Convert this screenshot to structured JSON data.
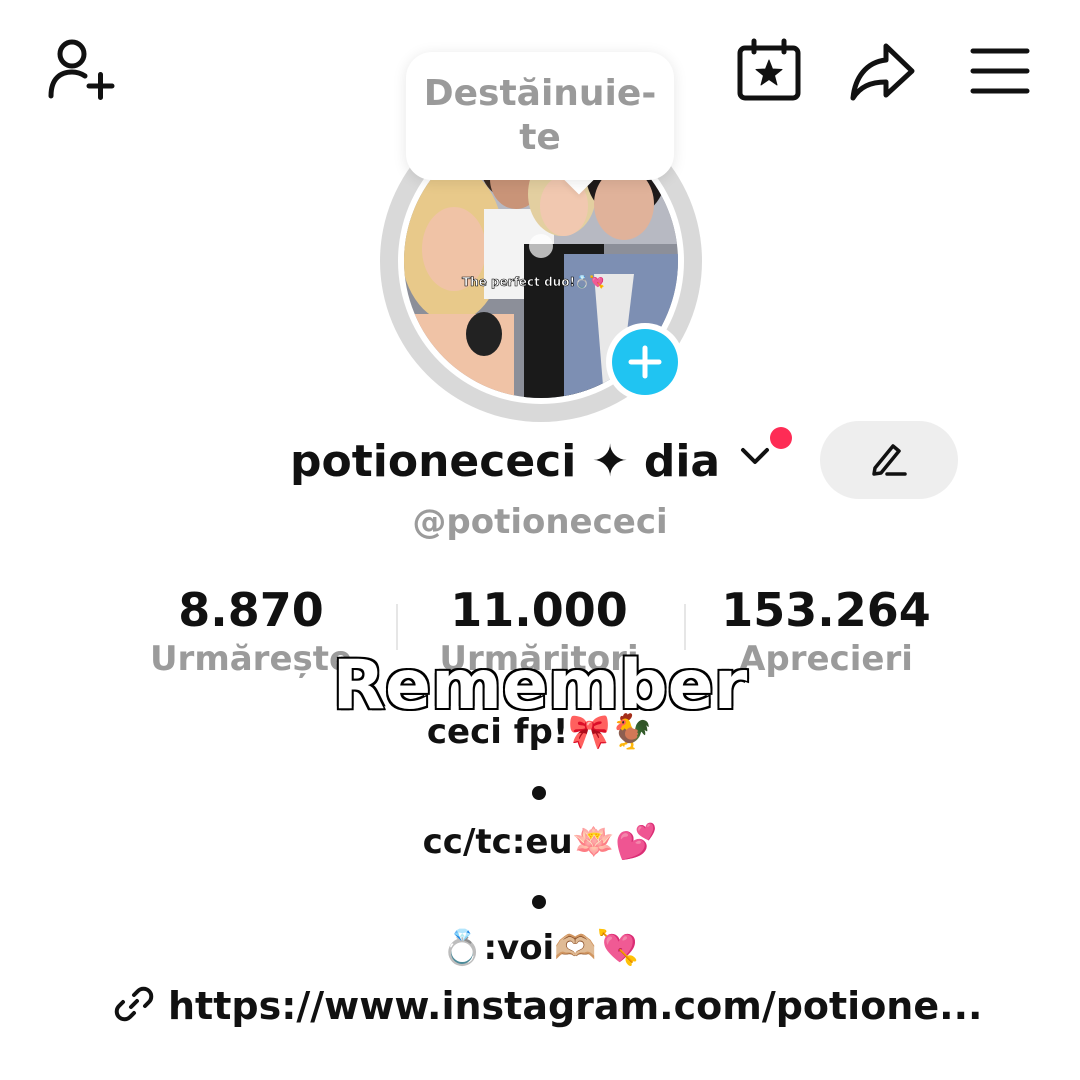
{
  "header": {
    "icons": [
      "add-friend-icon",
      "calendar-star-icon",
      "share-icon",
      "menu-icon"
    ]
  },
  "story_bubble": {
    "text": "Destăinuie-te"
  },
  "avatar": {
    "caption": "The perfect duo!💍💘"
  },
  "profile": {
    "display_name": "potionececi ✦ dia",
    "handle": "@potionececi"
  },
  "stats": {
    "following_value": "8.870",
    "following_label": "Urmărește",
    "followers_value": "11.000",
    "followers_label": "Urmăritori",
    "likes_value": "153.264",
    "likes_label": "Aprecieri"
  },
  "overlay": {
    "caption": "Remember"
  },
  "bio": {
    "line1": "ceci fp!🎀🐓",
    "line2": "cc/tc:eu🪷💕",
    "line3": "💍:voi🫶🏼💘"
  },
  "link": {
    "text": "https://www.instagram.com/potione..."
  },
  "colors": {
    "accent_blue": "#20c4f2",
    "notification_red": "#fe2c55",
    "muted_gray": "#9b9b9b"
  }
}
